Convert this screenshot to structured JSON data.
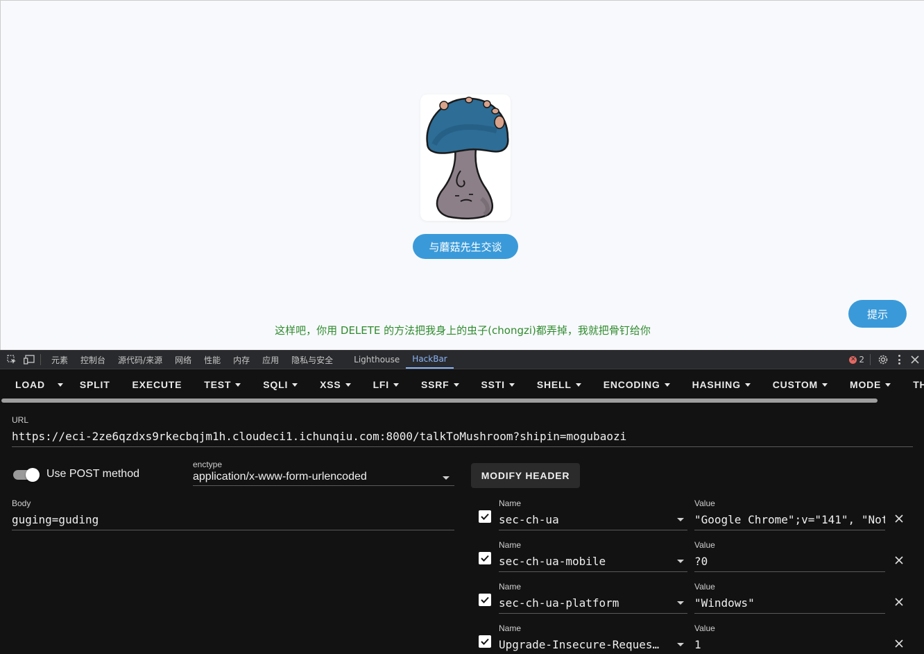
{
  "page": {
    "talk_button": "与蘑菇先生交谈",
    "hint_button": "提示",
    "message": "这样吧，你用 DELETE 的方法把我身上的虫子(chongzi)都弄掉，我就把骨钉给你"
  },
  "devtools": {
    "tabs": [
      "元素",
      "控制台",
      "源代码/来源",
      "网络",
      "性能",
      "内存",
      "应用",
      "隐私与安全",
      "Lighthouse",
      "HackBar"
    ],
    "active_tab": "HackBar",
    "error_count": "2"
  },
  "hackbar": {
    "toolbar": [
      {
        "label": "LOAD",
        "dropdown": false
      },
      {
        "label": "SPLIT",
        "dropdown": false
      },
      {
        "label": "EXECUTE",
        "dropdown": false
      },
      {
        "label": "TEST",
        "dropdown": true
      },
      {
        "label": "SQLI",
        "dropdown": true
      },
      {
        "label": "XSS",
        "dropdown": true
      },
      {
        "label": "LFI",
        "dropdown": true
      },
      {
        "label": "SSRF",
        "dropdown": true
      },
      {
        "label": "SSTI",
        "dropdown": true
      },
      {
        "label": "SHELL",
        "dropdown": true
      },
      {
        "label": "ENCODING",
        "dropdown": true
      },
      {
        "label": "HASHING",
        "dropdown": true
      },
      {
        "label": "CUSTOM",
        "dropdown": true
      },
      {
        "label": "MODE",
        "dropdown": true
      },
      {
        "label": "TH",
        "dropdown": false
      }
    ],
    "url_label": "URL",
    "url": "https://eci-2ze6qzdxs9rkecbqjm1h.cloudeci1.ichunqiu.com:8000/talkToMushroom?shipin=mogubaozi",
    "use_post_label": "Use POST method",
    "use_post": true,
    "enctype_label": "enctype",
    "enctype": "application/x-www-form-urlencoded",
    "modify_header_label": "MODIFY HEADER",
    "body_label": "Body",
    "body": "guging=guding",
    "name_label": "Name",
    "value_label": "Value",
    "headers": [
      {
        "name": "sec-ch-ua",
        "value": "\"Google Chrome\";v=\"141\", \"Not",
        "checked": true
      },
      {
        "name": "sec-ch-ua-mobile",
        "value": "?0",
        "checked": true
      },
      {
        "name": "sec-ch-ua-platform",
        "value": "\"Windows\"",
        "checked": true
      },
      {
        "name": "Upgrade-Insecure-Reques…",
        "value": "1",
        "checked": true
      }
    ]
  }
}
